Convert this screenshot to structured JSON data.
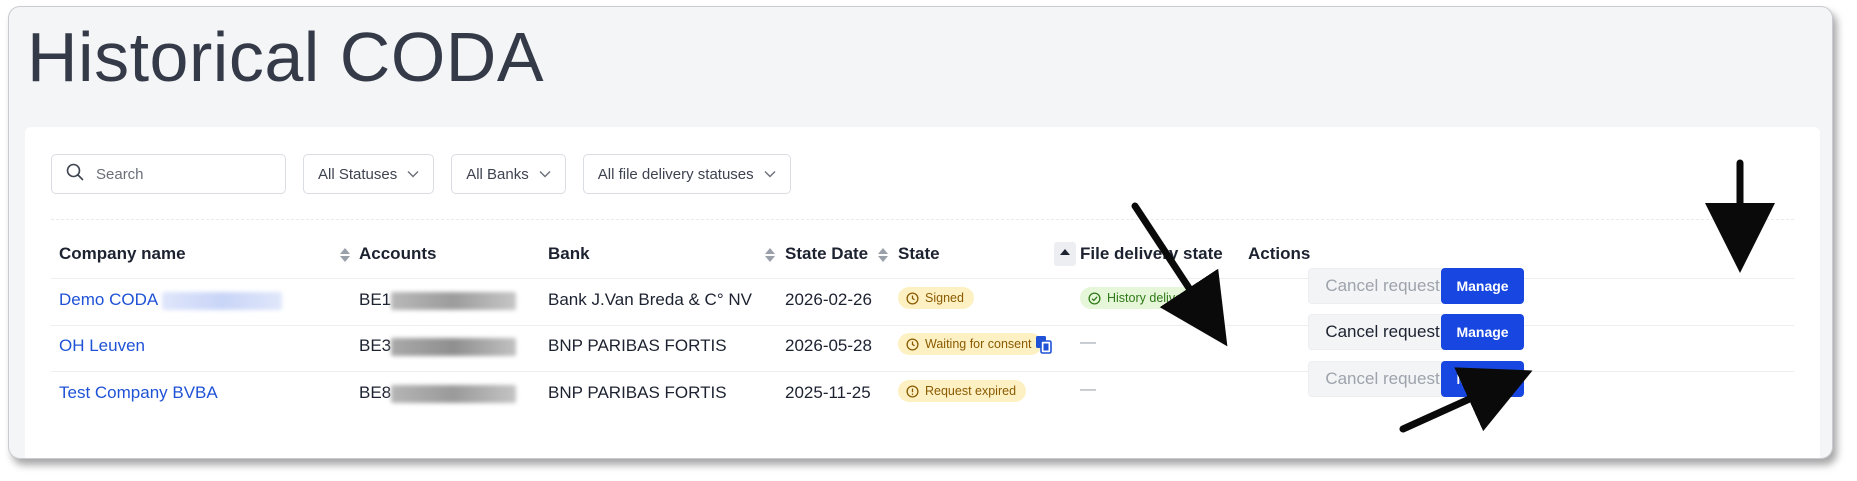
{
  "page": {
    "title": "Historical CODA"
  },
  "filters": {
    "search_placeholder": "Search",
    "status": "All Statuses",
    "bank": "All Banks",
    "delivery": "All file delivery statuses"
  },
  "columns": {
    "company": "Company name",
    "accounts": "Accounts",
    "bank": "Bank",
    "state_date": "State Date",
    "state": "State",
    "delivery": "File delivery state",
    "actions": "Actions"
  },
  "rows": [
    {
      "company": "Demo CODA",
      "account_prefix": "BE1",
      "bank": "Bank J.Van Breda & C° NV",
      "state_date": "2026-02-26",
      "state": "Signed",
      "delivery": "History delivered",
      "cancel_label": "Cancel request",
      "cancel_enabled": false,
      "manage_label": "Manage"
    },
    {
      "company": "OH Leuven",
      "account_prefix": "BE3",
      "bank": "BNP PARIBAS FORTIS",
      "state_date": "2026-05-28",
      "state": "Waiting for consent",
      "delivery": "—",
      "cancel_label": "Cancel request",
      "cancel_enabled": true,
      "manage_label": "Manage"
    },
    {
      "company": "Test Company BVBA",
      "account_prefix": "BE8",
      "bank": "BNP PARIBAS FORTIS",
      "state_date": "2025-11-25",
      "state": "Request expired",
      "delivery": "—",
      "cancel_label": "Cancel request",
      "cancel_enabled": false,
      "manage_label": "Manage"
    }
  ],
  "colors": {
    "accent": "#1746e0",
    "link": "#1f52d6",
    "warning_bg": "#fdf1c4",
    "success_bg": "#e6f6d9"
  }
}
